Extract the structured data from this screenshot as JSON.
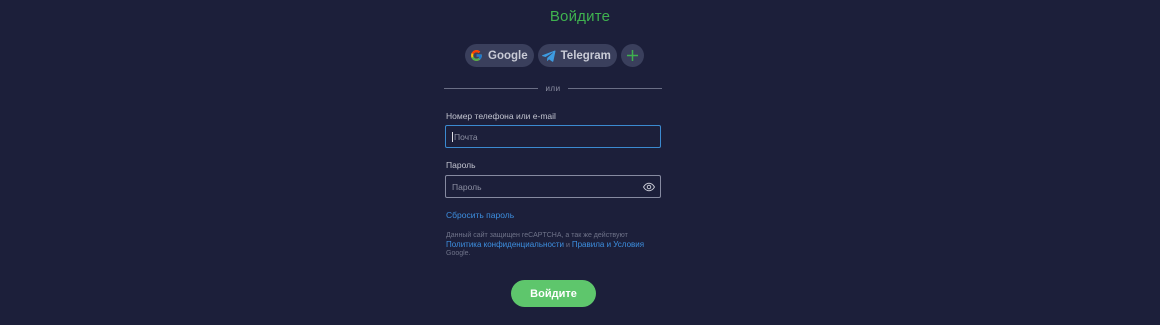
{
  "form": {
    "title": "Войдите",
    "social": {
      "google_label": "Google",
      "telegram_label": "Telegram",
      "more_icon": "plus-icon"
    },
    "divider_text": "или",
    "login": {
      "label": "Номер телефона или e-mail",
      "placeholder": "Почта",
      "value": ""
    },
    "password": {
      "label": "Пароль",
      "placeholder": "Пароль",
      "value": "",
      "toggle_icon": "eye-icon"
    },
    "reset_link": "Сбросить пароль",
    "legal": {
      "prefix": "Данный сайт защищен reCAPTCHA, а так же действуют",
      "privacy_link": "Политика конфиденциальности",
      "and": "и",
      "terms_link": "Правила и Условия",
      "suffix": "Google."
    },
    "submit_label": "Войдите"
  },
  "colors": {
    "background": "#1c1f3a",
    "title": "#3fb24f",
    "link": "#3d8fe0",
    "submit": "#5ec66c",
    "focus_border": "#3b8ad0"
  }
}
